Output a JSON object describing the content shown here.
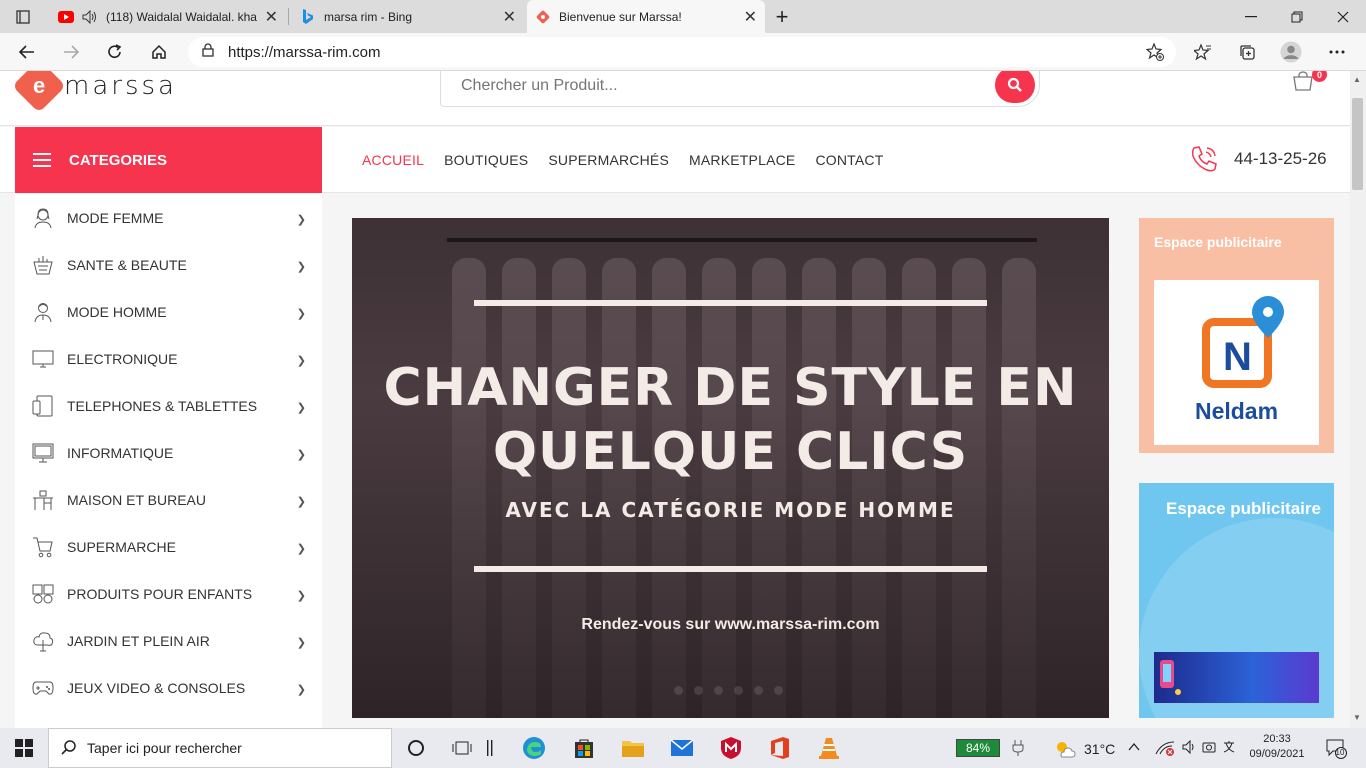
{
  "browser": {
    "tabs": [
      {
        "title": "(118) Waidalal Waidalal. kha",
        "favicon": "youtube-icon",
        "close": "✕"
      },
      {
        "title": "marsa rim - Bing",
        "favicon": "bing-icon",
        "close": "✕"
      },
      {
        "title": "Bienvenue sur Marssa!",
        "favicon": "marssa-icon",
        "close": "✕"
      }
    ],
    "new_tab": "+",
    "url": "https://marssa-rim.com",
    "accent": "#f6344d"
  },
  "header": {
    "logo_letter": "e",
    "logo_text": "marssa",
    "search_placeholder": "Chercher un Produit...",
    "cart_count": "0"
  },
  "nav": {
    "categories_label": "CATEGORIES",
    "links": [
      "ACCUEIL",
      "BOUTIQUES",
      "SUPERMARCHÉS",
      "MARKETPLACE",
      "CONTACT"
    ],
    "phone": "44-13-25-26"
  },
  "sidebar": {
    "items": [
      {
        "label": "MODE FEMME",
        "icon": "woman-icon"
      },
      {
        "label": "SANTE & BEAUTE",
        "icon": "beauty-basket-icon"
      },
      {
        "label": "MODE HOMME",
        "icon": "man-icon"
      },
      {
        "label": "ELECTRONIQUE",
        "icon": "monitor-icon"
      },
      {
        "label": "TELEPHONES & TABLETTES",
        "icon": "phone-tablet-icon"
      },
      {
        "label": "INFORMATIQUE",
        "icon": "computer-icon"
      },
      {
        "label": "MAISON ET BUREAU",
        "icon": "desk-icon"
      },
      {
        "label": "SUPERMARCHE",
        "icon": "cart-icon"
      },
      {
        "label": "PRODUITS POUR ENFANTS",
        "icon": "kids-icon"
      },
      {
        "label": "JARDIN ET PLEIN AIR",
        "icon": "tree-icon"
      },
      {
        "label": "JEUX VIDEO & CONSOLES",
        "icon": "gamepad-icon"
      }
    ]
  },
  "hero": {
    "title_line1": "CHANGER DE STYLE EN",
    "title_line2": "QUELQUE CLICS",
    "subtitle": "AVEC LA CATÉGORIE MODE HOMME",
    "footer": "Rendez-vous sur www.marssa-rim.com"
  },
  "ads": [
    {
      "title": "Espace publicitaire",
      "brand": "Neldam"
    },
    {
      "title": "Espace publicitaire"
    }
  ],
  "taskbar": {
    "search_placeholder": "Taper ici pour rechercher",
    "battery": "84%",
    "temperature": "31°C",
    "time": "20:33",
    "date": "09/09/2021",
    "notifications": "10"
  }
}
